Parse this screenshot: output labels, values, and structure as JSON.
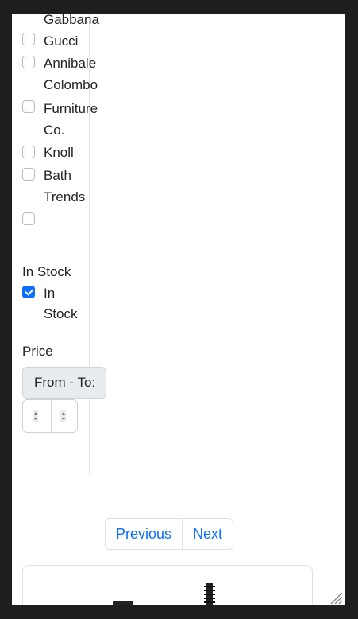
{
  "filters": {
    "brands": [
      {
        "label": "Gabbana",
        "checked": false
      },
      {
        "label": "Gucci",
        "checked": false
      },
      {
        "label_line1": "Annibale",
        "label_line2": "Colombo",
        "checked": false
      },
      {
        "label_line1": "Furniture",
        "label_line2": "Co.",
        "checked": false
      },
      {
        "label": "Knoll",
        "checked": false
      },
      {
        "label_line1": "Bath",
        "label_line2": "Trends",
        "checked": false
      },
      {
        "label": "",
        "checked": false
      }
    ],
    "in_stock": {
      "title": "In Stock",
      "option_line1": "In",
      "option_line2": "Stock",
      "checked": true
    },
    "price": {
      "title": "Price",
      "range_label": "From - To:"
    }
  },
  "pagination": {
    "previous_label": "Previous",
    "next_label": "Next"
  },
  "colors": {
    "accent": "#0d6efd",
    "border": "#dee2e6",
    "window_bg": "#1e1e1e"
  }
}
